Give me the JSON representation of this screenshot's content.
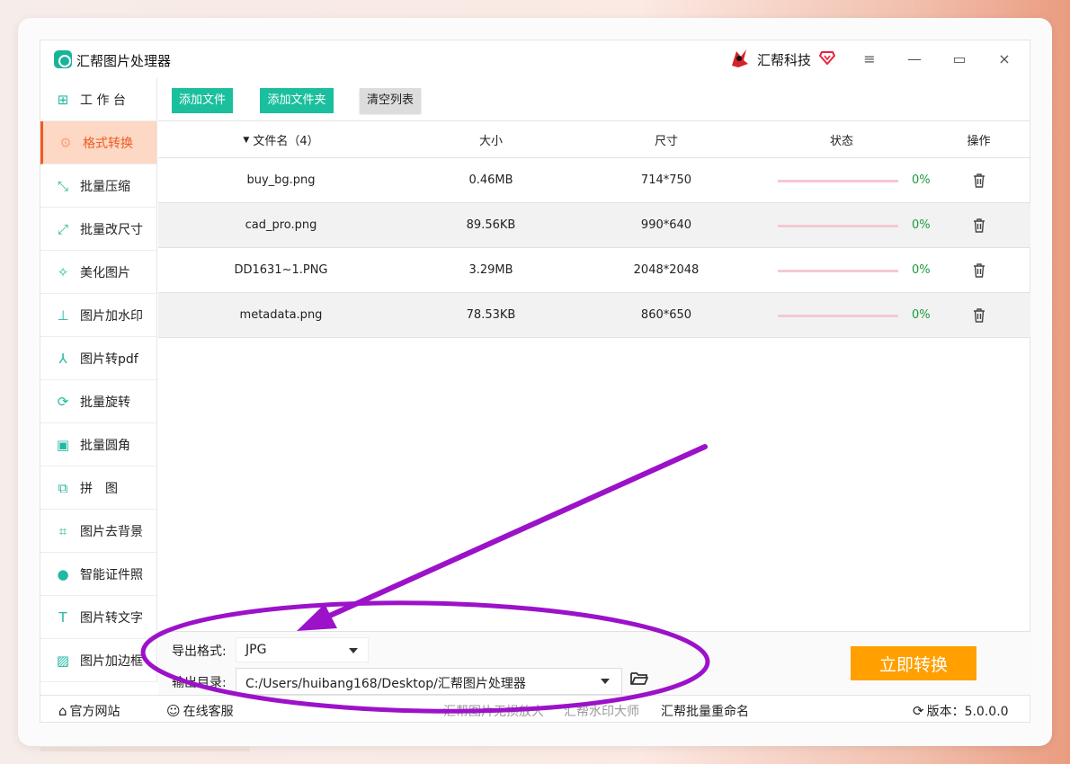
{
  "window": {
    "title": "汇帮图片处理器",
    "brand": "汇帮科技",
    "controls": {
      "menu": "≡",
      "minimize": "—",
      "maximize": "▭",
      "close": "×"
    }
  },
  "sidebar": {
    "items": [
      {
        "label": "工 作 台",
        "icon": "grid-icon",
        "glyph": "⊞"
      },
      {
        "label": "格式转换",
        "icon": "gear-icon",
        "glyph": "⚙"
      },
      {
        "label": "批量压缩",
        "icon": "compress-icon",
        "glyph": "⤡"
      },
      {
        "label": "批量改尺寸",
        "icon": "resize-icon",
        "glyph": "⤢"
      },
      {
        "label": "美化图片",
        "icon": "beautify-icon",
        "glyph": "✧"
      },
      {
        "label": "图片加水印",
        "icon": "watermark-icon",
        "glyph": "⊥"
      },
      {
        "label": "图片转pdf",
        "icon": "pdf-icon",
        "glyph": "⅄"
      },
      {
        "label": "批量旋转",
        "icon": "rotate-icon",
        "glyph": "⟳"
      },
      {
        "label": "批量圆角",
        "icon": "image-icon",
        "glyph": "▣"
      },
      {
        "label": "拼　图",
        "icon": "puzzle-icon",
        "glyph": "⧉"
      },
      {
        "label": "图片去背景",
        "icon": "crop-icon",
        "glyph": "⌗"
      },
      {
        "label": "智能证件照",
        "icon": "person-icon",
        "glyph": "●"
      },
      {
        "label": "图片转文字",
        "icon": "text-icon",
        "glyph": "T"
      },
      {
        "label": "图片加边框",
        "icon": "frame-icon",
        "glyph": "▨"
      }
    ],
    "active_index": 1
  },
  "toolbar": {
    "add_file": "添加文件",
    "add_folder": "添加文件夹",
    "clear_list": "清空列表"
  },
  "table": {
    "headers": {
      "name": "文件名（4）",
      "size": "大小",
      "dimensions": "尺寸",
      "status": "状态",
      "actions": "操作"
    },
    "rows": [
      {
        "name": "buy_bg.png",
        "size": "0.46MB",
        "dimensions": "714*750",
        "progress": "0%"
      },
      {
        "name": "cad_pro.png",
        "size": "89.56KB",
        "dimensions": "990*640",
        "progress": "0%"
      },
      {
        "name": "DD1631~1.PNG",
        "size": "3.29MB",
        "dimensions": "2048*2048",
        "progress": "0%"
      },
      {
        "name": "metadata.png",
        "size": "78.53KB",
        "dimensions": "860*650",
        "progress": "0%"
      }
    ]
  },
  "output": {
    "format_label": "导出格式:",
    "format_value": "JPG",
    "dir_label": "输出目录:",
    "dir_value": "C:/Users/huibang168/Desktop/汇帮图片处理器",
    "convert_button": "立即转换"
  },
  "footer": {
    "official_site": "官方网站",
    "online_service": "在线客服",
    "lossless": "汇帮图片无损放大",
    "watermark": "汇帮水印大师",
    "rename": "汇帮批量重命名",
    "version": "版本：5.0.0.0"
  },
  "colors": {
    "accent": "#1bbf9d",
    "active_bg": "#fcd8c5",
    "active_text": "#f15a24",
    "convert": "#ffa000",
    "annotation": "#9b12c9",
    "progress_text": "#1a9d3a"
  }
}
